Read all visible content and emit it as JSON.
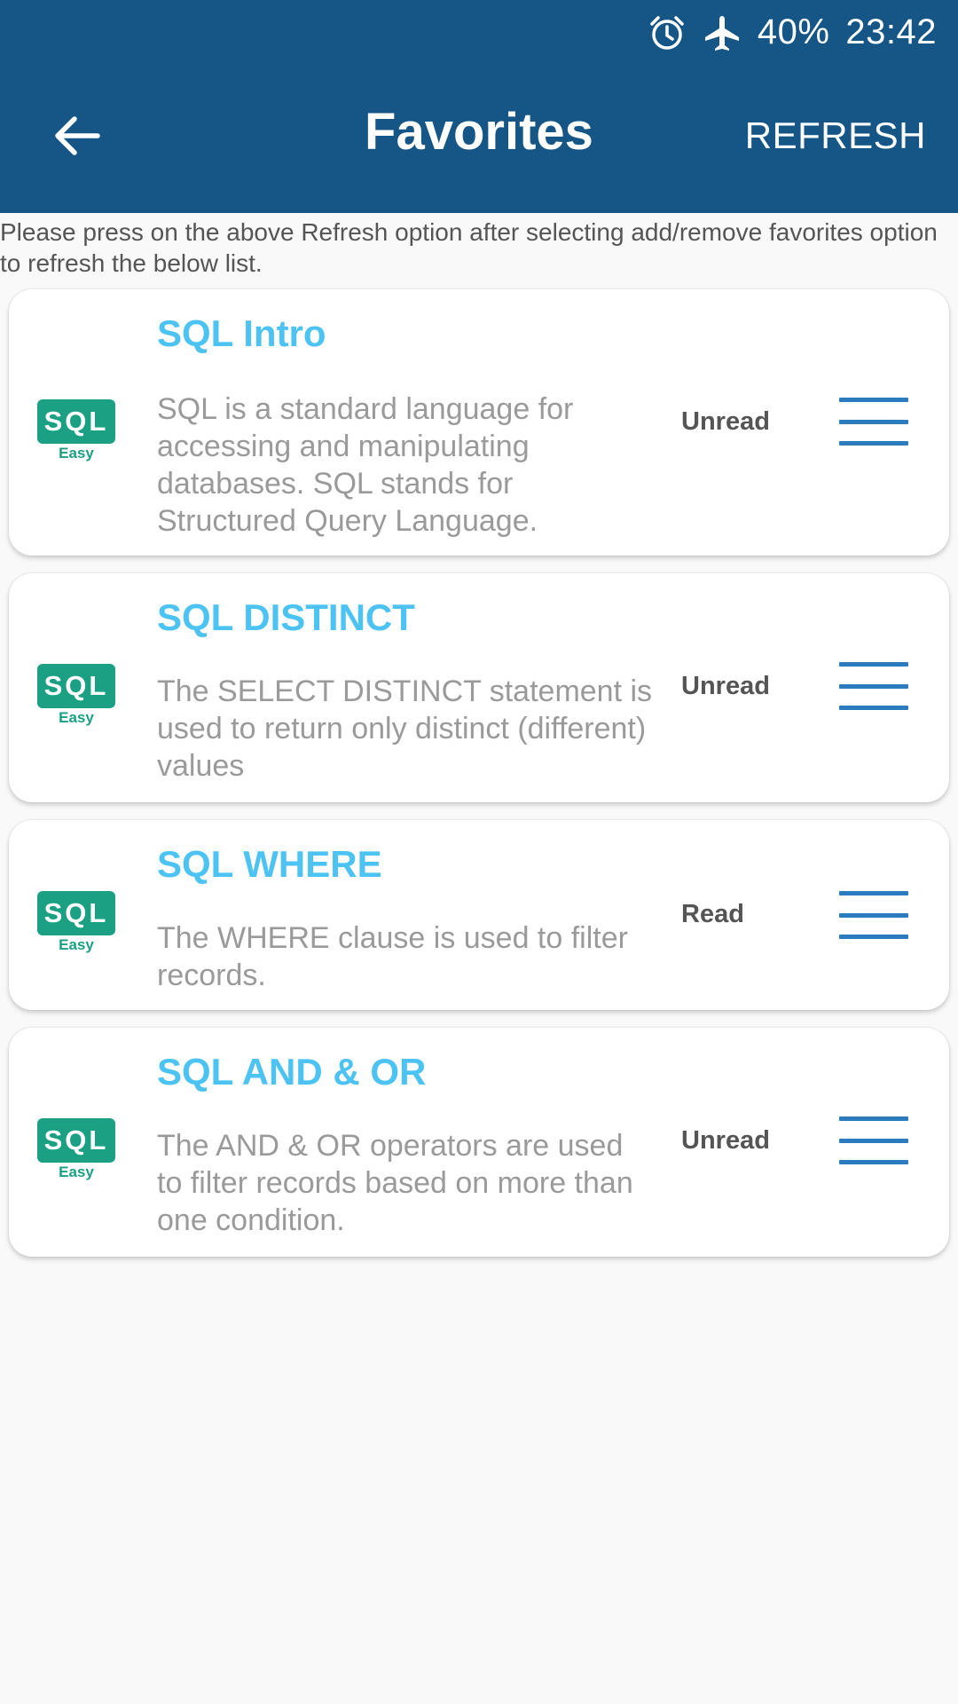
{
  "status_bar": {
    "icons": [
      "alarm-icon",
      "airplane-icon"
    ],
    "battery": "40%",
    "time": "23:42"
  },
  "app_bar": {
    "back_icon": "arrow-left-icon",
    "title": "Favorites",
    "refresh_label": "REFRESH"
  },
  "notice": "Please press on the above Refresh option after selecting add/remove favorites option to refresh the below list.",
  "logo": {
    "main": "SQL",
    "sub": "Easy"
  },
  "items": [
    {
      "title": "SQL Intro",
      "description": "SQL is a standard language for accessing and manipulating databases. SQL stands for Structured Query Language.",
      "status": "Unread"
    },
    {
      "title": "SQL DISTINCT",
      "description": "The SELECT DISTINCT statement is used to return only distinct (different) values",
      "status": "Unread"
    },
    {
      "title": "SQL WHERE",
      "description": "The WHERE clause is used to filter records.",
      "status": "Read"
    },
    {
      "title": "SQL AND & OR",
      "description": "The AND & OR operators are used to filter records based on more than one condition.",
      "status": "Unread"
    }
  ],
  "colors": {
    "app_bar": "#155686",
    "title_text": "#4cc3f3",
    "logo_green": "#1ba084",
    "menu_icon": "#2b7cbf"
  }
}
